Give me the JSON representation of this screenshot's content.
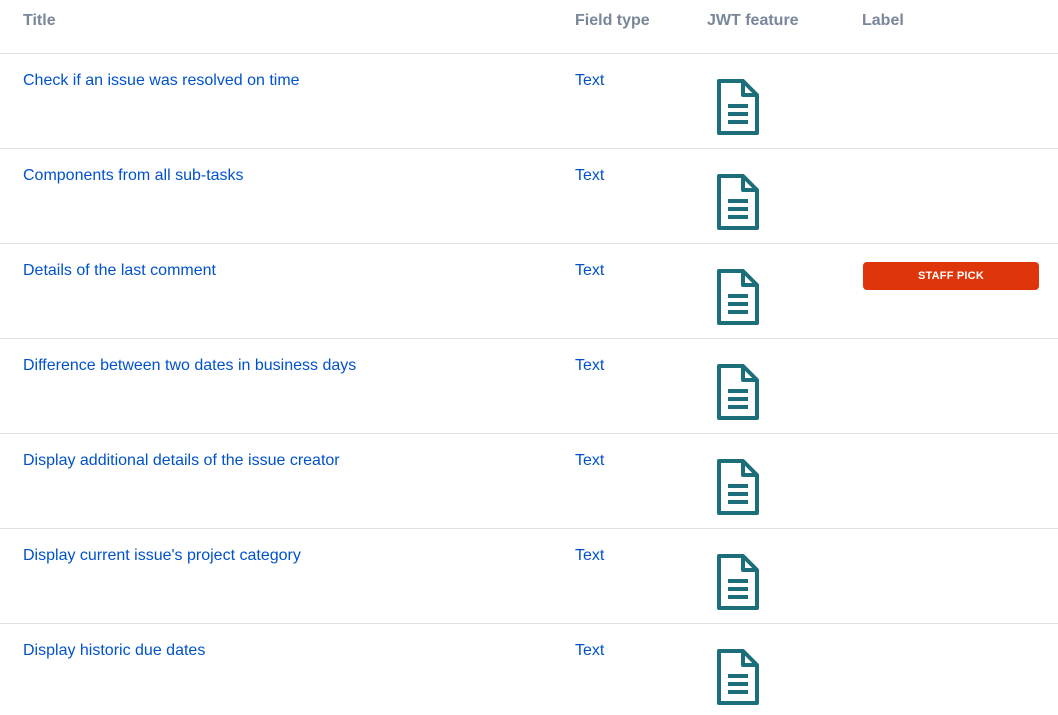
{
  "header": {
    "title": "Title",
    "field_type": "Field type",
    "jwt_feature": "JWT feature",
    "label": "Label"
  },
  "icon": {
    "name": "document-icon",
    "color": "#1b6e7a"
  },
  "badge_color": "#de350b",
  "rows": [
    {
      "title": "Check if an issue was resolved on time",
      "field_type": "Text",
      "label": ""
    },
    {
      "title": "Components from all sub-tasks",
      "field_type": "Text",
      "label": ""
    },
    {
      "title": "Details of the last comment",
      "field_type": "Text",
      "label": "STAFF PICK"
    },
    {
      "title": "Difference between two dates in business days",
      "field_type": "Text",
      "label": ""
    },
    {
      "title": "Display additional details of the issue creator",
      "field_type": "Text",
      "label": ""
    },
    {
      "title": "Display current issue's project category",
      "field_type": "Text",
      "label": ""
    },
    {
      "title": "Display historic due dates",
      "field_type": "Text",
      "label": ""
    }
  ]
}
